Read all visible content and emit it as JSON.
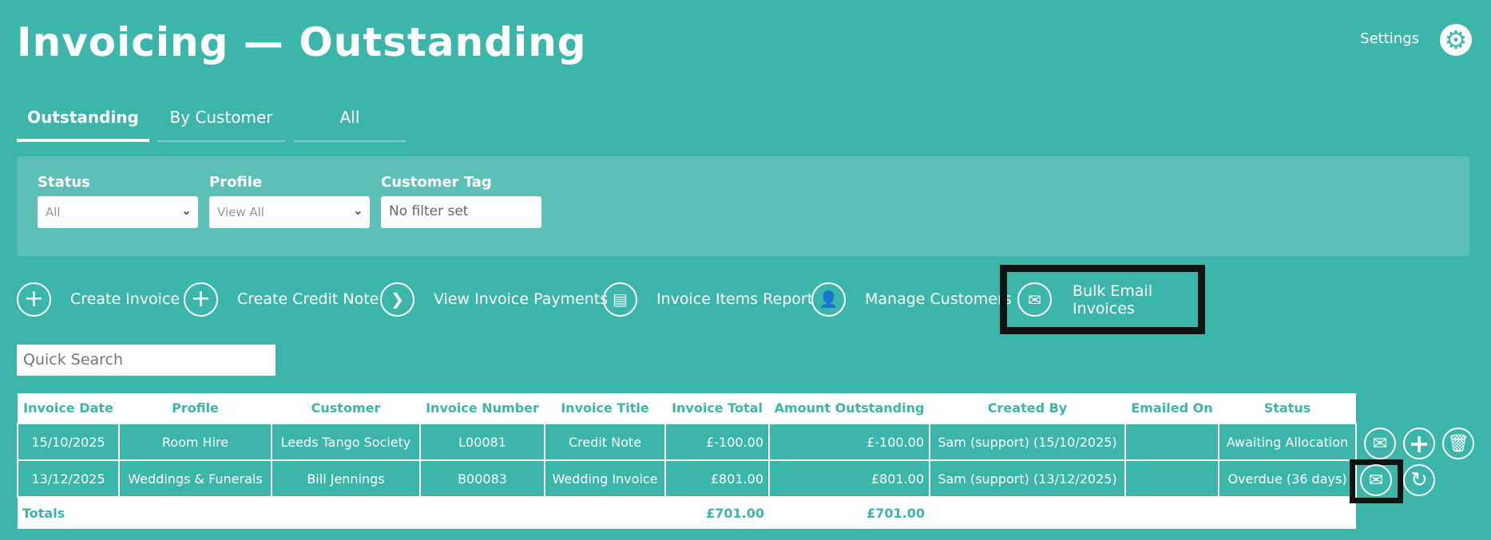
{
  "header": {
    "title": "Invoicing — Outstanding",
    "settings_label": "Settings",
    "settings_icon": "gear-icon"
  },
  "tabs": [
    {
      "label": "Outstanding",
      "active": true
    },
    {
      "label": "By Customer"
    },
    {
      "label": "All"
    }
  ],
  "filters": {
    "status_label": "Status",
    "status_value": "All",
    "profile_label": "Profile",
    "profile_value": "View All",
    "tag_label": "Customer Tag",
    "tag_placeholder": "No filter set"
  },
  "actions": [
    {
      "label": "Create Invoice",
      "icon": "plus-icon"
    },
    {
      "label": "Create Credit Note",
      "icon": "plus-icon"
    },
    {
      "label": "View Invoice Payments",
      "icon": "chevron-right-icon"
    },
    {
      "label": "Invoice Items Report",
      "icon": "document-icon"
    },
    {
      "label": "Manage Customers",
      "icon": "user-settings-icon"
    },
    {
      "label": "Bulk Email Invoices",
      "icon": "mail-icon"
    }
  ],
  "search": {
    "placeholder": "Quick Search"
  },
  "table": {
    "columns": [
      "Invoice Date",
      "Profile",
      "Customer",
      "Invoice Number",
      "Invoice Title",
      "Invoice Total",
      "Amount Outstanding",
      "Created By",
      "Emailed On",
      "Status"
    ],
    "rows": [
      [
        "15/10/2025",
        "Room Hire",
        "Leeds Tango Society",
        "L00081",
        "Credit Note",
        "£-100.00",
        "£-100.00",
        "Sam (support) (15/10/2025)",
        "",
        "Awaiting Allocation"
      ],
      [
        "13/12/2025",
        "Weddings & Funerals",
        "Bill Jennings",
        "B00083",
        "Wedding Invoice",
        "£801.00",
        "£801.00",
        "Sam (support) (13/12/2025)",
        "",
        "Overdue (36 days)"
      ]
    ],
    "totals": {
      "label": "Totals",
      "invoice_total": "£701.00",
      "amount_outstanding": "£701.00"
    }
  },
  "colors": {
    "background": "#3db6aa",
    "panel": "#5dc0b6",
    "highlight": "#0b1613"
  }
}
